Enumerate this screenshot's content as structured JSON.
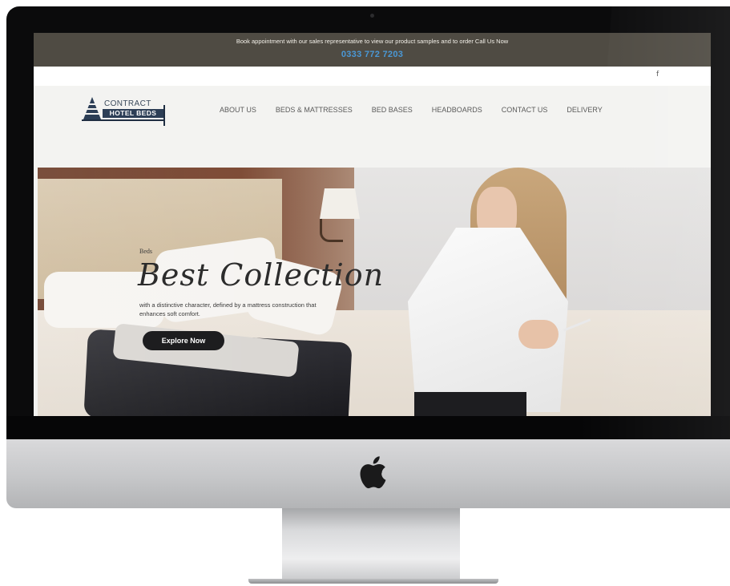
{
  "topbar": {
    "announcement": "Book appointment with our sales representative to view our product samples and to order Call Us Now",
    "phone": "0333 772 7203"
  },
  "social": {
    "facebook": "f"
  },
  "logo": {
    "line1": "CONTRACT",
    "line2": "HOTEL BEDS"
  },
  "nav": {
    "items": [
      {
        "label": "ABOUT US"
      },
      {
        "label": "BEDS & MATTRESSES"
      },
      {
        "label": "BED BASES"
      },
      {
        "label": "HEADBOARDS"
      },
      {
        "label": "CONTACT US"
      },
      {
        "label": "DELIVERY"
      }
    ]
  },
  "hero": {
    "eyebrow": "Beds",
    "title": "Best Collection",
    "description": "with a distinctive character, defined by a mattress construction that enhances soft comfort.",
    "button": "Explore Now"
  },
  "colors": {
    "topbar_bg": "#4f4b43",
    "phone_accent": "#4a98d6",
    "logo_navy": "#2c3e56",
    "button_bg": "#1d1d1f"
  },
  "icons": [
    "facebook-icon",
    "apple-logo-icon"
  ]
}
